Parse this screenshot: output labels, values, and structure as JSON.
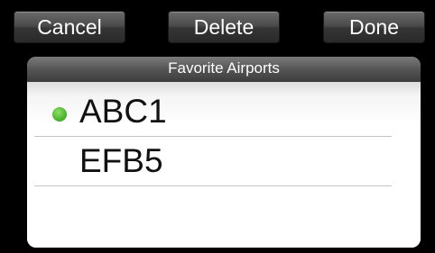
{
  "toolbar": {
    "cancel_label": "Cancel",
    "delete_label": "Delete",
    "done_label": "Done"
  },
  "panel": {
    "title": "Favorite Airports",
    "items": [
      {
        "label": "ABC1",
        "active": true
      },
      {
        "label": "EFB5",
        "active": false
      }
    ]
  },
  "colors": {
    "active_dot": "#4cb52d",
    "background": "#000000",
    "button": "#3d3d3d"
  }
}
